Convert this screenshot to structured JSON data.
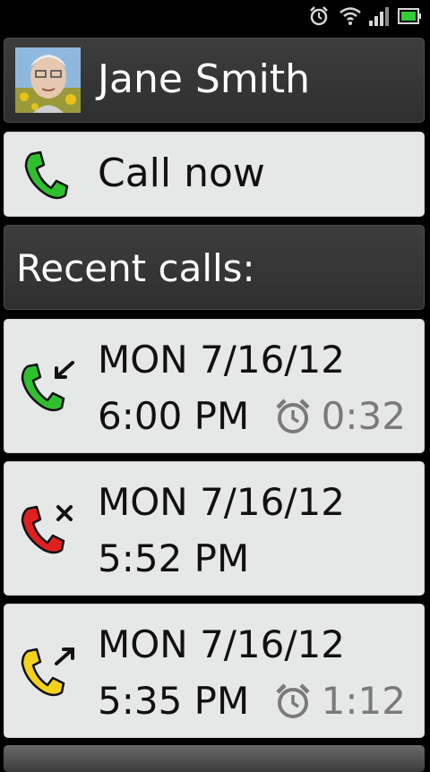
{
  "status_bar": {
    "icons": [
      "alarm-icon",
      "wifi-icon",
      "signal-icon",
      "battery-icon"
    ],
    "colors": {
      "battery": "#33cc33",
      "icons": "#d8d8d8"
    }
  },
  "contact": {
    "name": "Jane Smith",
    "avatar_icon": "contact-photo"
  },
  "call_now": {
    "label": "Call now",
    "icon": "phone-icon",
    "icon_color": "#2ec02e"
  },
  "recent": {
    "label": "Recent calls:"
  },
  "calls": [
    {
      "type": "incoming",
      "icon": "incoming-call-icon",
      "icon_color": "#2ec02e",
      "date": "MON 7/16/12",
      "time": "6:00 PM",
      "duration": "0:32"
    },
    {
      "type": "missed",
      "icon": "missed-call-icon",
      "icon_color": "#e02020",
      "date": "MON 7/16/12",
      "time": "5:52 PM",
      "duration": ""
    },
    {
      "type": "outgoing",
      "icon": "outgoing-call-icon",
      "icon_color": "#f2d21b",
      "date": "MON 7/16/12",
      "time": "5:35 PM",
      "duration": "1:12"
    }
  ]
}
